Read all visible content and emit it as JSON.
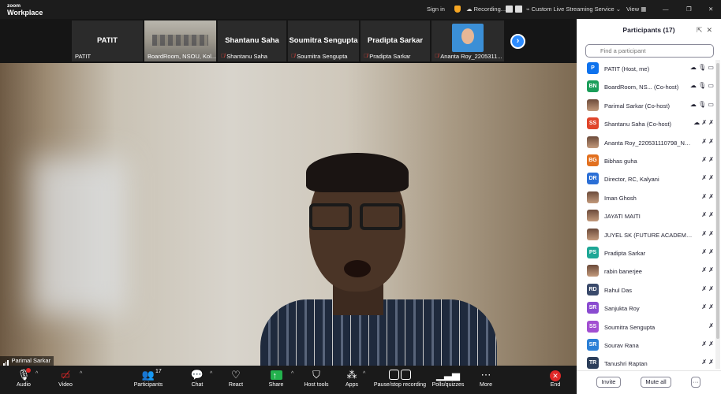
{
  "app": {
    "logo_line1": "zoom",
    "logo_line2": "Workplace"
  },
  "titlebar": {
    "sign_in": "Sign in",
    "recording": "Recording...",
    "streaming": "Custom Live Streaming Service",
    "streaming_caret": "⌄",
    "view": "View",
    "minimize": "—",
    "restore": "❐",
    "close": "✕"
  },
  "gallery": [
    {
      "big_name": "PATIT",
      "caption": "PATIT"
    },
    {
      "big_name": "",
      "caption": "BoardRoom, NSOU, Kol..."
    },
    {
      "big_name": "Shantanu Saha",
      "caption": "Shantanu Saha"
    },
    {
      "big_name": "Soumitra  Sengupta",
      "caption": "Soumitra Sengupta"
    },
    {
      "big_name": "Pradipta Sarkar",
      "caption": "Pradipta Sarkar"
    },
    {
      "big_name": "",
      "caption": "Ananta Roy_2205311..."
    }
  ],
  "gallery_next": "›",
  "video": {
    "speaker": "Parimal Sarkar"
  },
  "toolbar": {
    "audio": "Audio",
    "video": "Video",
    "participants": "Participants",
    "participants_count": "17",
    "chat": "Chat",
    "react": "React",
    "share": "Share",
    "host_tools": "Host tools",
    "apps": "Apps",
    "pause_recording": "Pause/stop recording",
    "polls": "Polls/quizzes",
    "more": "More",
    "end": "End",
    "caret": "^"
  },
  "panel": {
    "title": "Participants (17)",
    "popout": "⇱",
    "close": "✕",
    "search_placeholder": "Find a participant",
    "invite": "Invite",
    "mute_all": "Mute all",
    "more": "···"
  },
  "participants": [
    {
      "initials": "P",
      "color": "#0e72ed",
      "name": "PATIT (Host, me)",
      "icons": "☁ 🎙 ▭",
      "muted": false
    },
    {
      "initials": "BN",
      "color": "#1b9e5a",
      "name": "BoardRoom, NS...  (Co-host)",
      "icons": "☁ 🎙 ▭",
      "muted": false
    },
    {
      "initials": "",
      "color": "",
      "name": "Parimal Sarkar (Co-host)",
      "icons": "☁ 🎙 ▭",
      "muted": false
    },
    {
      "initials": "SS",
      "color": "#e0452b",
      "name": "Shantanu Saha (Co-host)",
      "icons": "☁ ✗ ✗",
      "muted": true
    },
    {
      "initials": "",
      "color": "",
      "name": "Ananta Roy_220531110798_NS...",
      "icons": "✗ ✗",
      "muted": true
    },
    {
      "initials": "BG",
      "color": "#e2701f",
      "name": "Bibhas guha",
      "icons": "✗ ✗",
      "muted": true
    },
    {
      "initials": "DR",
      "color": "#2b6fd6",
      "name": "Director, RC, Kalyani",
      "icons": "✗ ✗",
      "muted": true
    },
    {
      "initials": "",
      "color": "",
      "name": "Iman Ghosh",
      "icons": "✗ ✗",
      "muted": true
    },
    {
      "initials": "",
      "color": "",
      "name": "JAYATI MAITI",
      "icons": "✗ ✗",
      "muted": true
    },
    {
      "initials": "",
      "color": "",
      "name": "JUYEL SK (FUTURE ACADEMY C...",
      "icons": "✗ ✗",
      "muted": true
    },
    {
      "initials": "PS",
      "color": "#1ea796",
      "name": "Pradipta Sarkar",
      "icons": "✗ ✗",
      "muted": true
    },
    {
      "initials": "",
      "color": "",
      "name": "rabin banerjee",
      "icons": "✗ ✗",
      "muted": true
    },
    {
      "initials": "RD",
      "color": "#3a4a6b",
      "name": "Rahul Das",
      "icons": "✗ ✗",
      "muted": true
    },
    {
      "initials": "SR",
      "color": "#8a4bd0",
      "name": "Sanjukta Roy",
      "icons": "✗ ✗",
      "muted": true
    },
    {
      "initials": "SS",
      "color": "#a24fd1",
      "name": "Soumitra Sengupta",
      "icons": "✗",
      "muted": true
    },
    {
      "initials": "SR",
      "color": "#2b7fd6",
      "name": "Sourav Rana",
      "icons": "✗ ✗",
      "muted": true
    },
    {
      "initials": "TR",
      "color": "#2c3e5a",
      "name": "Tanushri Raptan",
      "icons": "✗ ✗",
      "muted": true
    }
  ]
}
